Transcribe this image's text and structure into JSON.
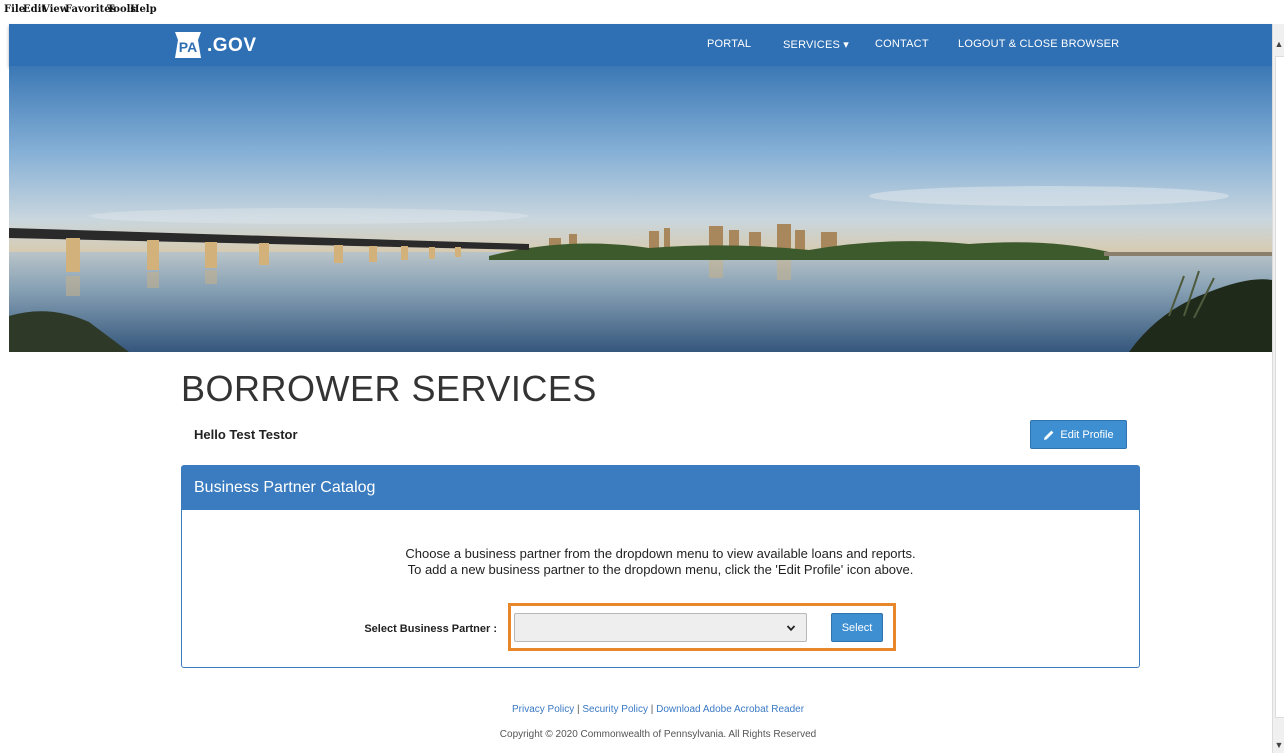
{
  "browser_menu": [
    "File",
    "Edit",
    "View",
    "Favorites",
    "Tools",
    "Help"
  ],
  "header": {
    "logo_key_text": "PA",
    "logo_suffix": ".GOV",
    "nav": [
      {
        "label": "PORTAL"
      },
      {
        "label": "SERVICES ▾"
      },
      {
        "label": "CONTACT"
      },
      {
        "label": "LOGOUT & CLOSE BROWSER"
      }
    ]
  },
  "page": {
    "title": "BORROWER SERVICES",
    "greeting": "Hello Test Testor",
    "edit_profile_label": "Edit Profile"
  },
  "panel": {
    "heading": "Business Partner Catalog",
    "instructions": [
      "Choose a business partner from the dropdown menu to view available loans and reports.",
      "To add a new business partner to the dropdown menu, click the 'Edit Profile' icon above."
    ],
    "select_label": "Select Business Partner :",
    "select_value": "",
    "select_button": "Select"
  },
  "footer": {
    "links": [
      "Privacy Policy",
      "Security Policy",
      "Download Adobe Acrobat Reader"
    ],
    "separator": "|",
    "copyright": "Copyright © 2020 Commonwealth of Pennsylvania. All Rights Reserved"
  },
  "colors": {
    "navbar": "#2f6fb3",
    "panel_header": "#3a7cbf",
    "button": "#3d8fd1",
    "highlight": "#e8872a",
    "link": "#3a79c4"
  },
  "icons": [
    "pencil-icon",
    "chevron-down-icon",
    "keystone-logo"
  ]
}
